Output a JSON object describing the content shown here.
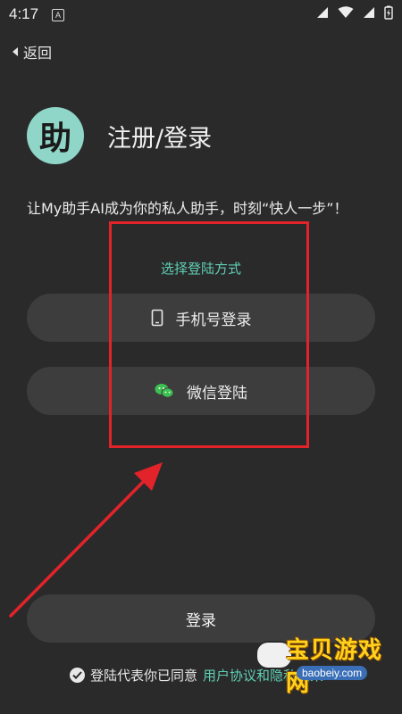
{
  "status_bar": {
    "time": "4:17",
    "notif": "A"
  },
  "nav": {
    "back_label": "返回"
  },
  "header": {
    "logo_char": "助",
    "title": "注册/登录"
  },
  "slogan": "让My助手AI成为你的私人助手，时刻“快人一步”！",
  "login_methods": {
    "label": "选择登陆方式",
    "phone_label": "手机号登录",
    "wechat_label": "微信登陆"
  },
  "login_button": "登录",
  "agreement": {
    "text": "登陆代表你已同意",
    "link": "用户协议和隐私政策"
  },
  "watermark": {
    "text": "宝贝游戏网",
    "sub": "baobeiy.com"
  },
  "colors": {
    "accent": "#5fcfb3",
    "highlight": "#e2232a",
    "background": "#2a2a2a",
    "logo_bg": "#8fd6c8"
  }
}
